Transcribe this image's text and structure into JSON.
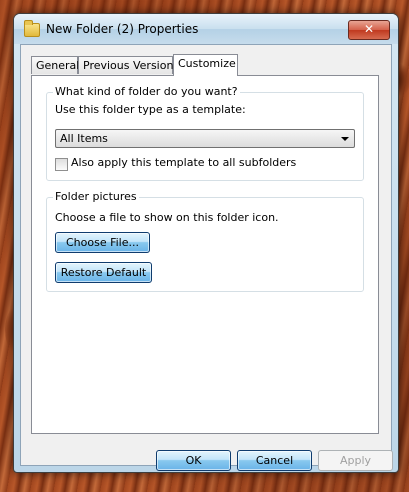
{
  "window": {
    "title": "New Folder (2) Properties",
    "close_glyph": "✕"
  },
  "tabs": [
    {
      "label": "General"
    },
    {
      "label": "Previous Versions"
    },
    {
      "label": "Customize"
    }
  ],
  "group_template": {
    "legend": "What kind of folder do you want?",
    "prompt": "Use this folder type as a template:",
    "selected": "All Items",
    "checkbox_label": "Also apply this template to all subfolders",
    "checkbox_checked": false
  },
  "group_pictures": {
    "legend": "Folder pictures",
    "prompt": "Choose a file to show on this folder icon.",
    "choose_label": "Choose File...",
    "restore_label": "Restore Default"
  },
  "buttons": {
    "ok": "OK",
    "cancel": "Cancel",
    "apply": "Apply"
  }
}
